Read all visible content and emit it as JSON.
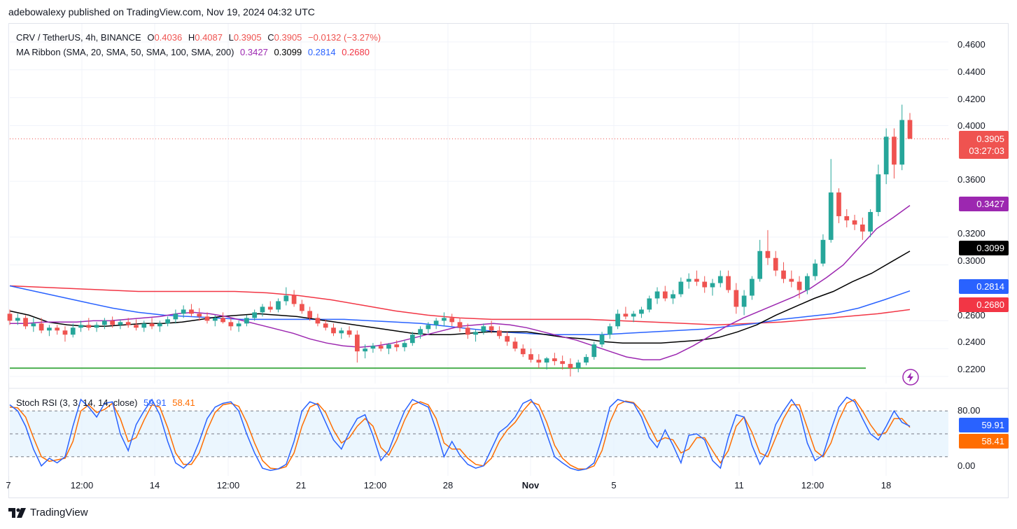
{
  "header": {
    "text": "adebowalexy published on TradingView.com, Nov 19, 2024 04:32 UTC"
  },
  "legend_main": {
    "symbol": "CRV / TetherUS, 4h, BINANCE",
    "o_label": "O",
    "o": "0.4036",
    "h_label": "H",
    "h": "0.4087",
    "l_label": "L",
    "l": "0.3905",
    "c_label": "C",
    "c": "0.3905",
    "change": "−0.0132 (−3.27%)"
  },
  "legend_ma": {
    "name": "MA Ribbon (SMA, 20, SMA, 50, SMA, 100, SMA, 200)",
    "v1": "0.3427",
    "v2": "0.3099",
    "v3": "0.2814",
    "v4": "0.2680"
  },
  "legend_rsi": {
    "name": "Stoch RSI (3, 3, 14, 14, close)",
    "k": "59.91",
    "d": "58.41"
  },
  "price_tags": {
    "last_price": "0.3905",
    "countdown": "03:27:03",
    "ma20": "0.3427",
    "ma50": "0.3099",
    "ma100": "0.2814",
    "ma200": "0.2680",
    "rsi_k": "59.91",
    "rsi_d": "58.41"
  },
  "colors": {
    "up": "#26a69a",
    "down": "#ef5350",
    "ma20": "#9c27b0",
    "ma50": "#000000",
    "ma100": "#2962ff",
    "ma200": "#f23645",
    "support": "#4caf50",
    "rsi_k": "#2962ff",
    "rsi_d": "#ff6d00",
    "rsi_band": "#e3f2fd"
  },
  "footer": {
    "brand": "TradingView",
    "logo_icon": "tradingview-logo-icon"
  },
  "chart_data": [
    {
      "type": "candlestick",
      "title": "CRV / TetherUS, 4h, BINANCE",
      "y_axis_ticks": [
        "0.4600",
        "0.4400",
        "0.4200",
        "0.4000",
        "0.3600",
        "0.3200",
        "0.3000",
        "0.2600",
        "0.2400",
        "0.2200"
      ],
      "x_axis_ticks": [
        "7",
        "12:00",
        "14",
        "12:00",
        "21",
        "12:00",
        "28",
        "Nov",
        "5",
        "11",
        "12:00",
        "18"
      ],
      "ylim": [
        0.215,
        0.47
      ],
      "ohlc": [
        [
          0.265,
          0.268,
          0.257,
          0.26
        ],
        [
          0.26,
          0.265,
          0.257,
          0.262
        ],
        [
          0.262,
          0.264,
          0.254,
          0.256
        ],
        [
          0.256,
          0.262,
          0.252,
          0.258
        ],
        [
          0.258,
          0.262,
          0.251,
          0.253
        ],
        [
          0.253,
          0.257,
          0.249,
          0.255
        ],
        [
          0.255,
          0.257,
          0.25,
          0.253
        ],
        [
          0.253,
          0.256,
          0.245,
          0.25
        ],
        [
          0.25,
          0.258,
          0.248,
          0.255
        ],
        [
          0.255,
          0.26,
          0.252,
          0.257
        ],
        [
          0.257,
          0.262,
          0.253,
          0.255
        ],
        [
          0.255,
          0.259,
          0.252,
          0.257
        ],
        [
          0.257,
          0.262,
          0.254,
          0.26
        ],
        [
          0.26,
          0.263,
          0.255,
          0.257
        ],
        [
          0.257,
          0.261,
          0.254,
          0.259
        ],
        [
          0.259,
          0.262,
          0.255,
          0.257
        ],
        [
          0.257,
          0.261,
          0.253,
          0.255
        ],
        [
          0.255,
          0.26,
          0.252,
          0.258
        ],
        [
          0.258,
          0.262,
          0.254,
          0.256
        ],
        [
          0.256,
          0.26,
          0.252,
          0.258
        ],
        [
          0.258,
          0.263,
          0.256,
          0.261
        ],
        [
          0.261,
          0.268,
          0.258,
          0.265
        ],
        [
          0.265,
          0.271,
          0.262,
          0.268
        ],
        [
          0.268,
          0.272,
          0.263,
          0.265
        ],
        [
          0.265,
          0.269,
          0.26,
          0.263
        ],
        [
          0.263,
          0.266,
          0.258,
          0.26
        ],
        [
          0.26,
          0.264,
          0.256,
          0.262
        ],
        [
          0.262,
          0.266,
          0.258,
          0.259
        ],
        [
          0.259,
          0.262,
          0.253,
          0.256
        ],
        [
          0.256,
          0.26,
          0.252,
          0.258
        ],
        [
          0.258,
          0.264,
          0.256,
          0.262
        ],
        [
          0.262,
          0.268,
          0.26,
          0.266
        ],
        [
          0.266,
          0.272,
          0.263,
          0.27
        ],
        [
          0.27,
          0.274,
          0.266,
          0.268
        ],
        [
          0.268,
          0.276,
          0.266,
          0.274
        ],
        [
          0.274,
          0.284,
          0.271,
          0.278
        ],
        [
          0.278,
          0.282,
          0.27,
          0.272
        ],
        [
          0.272,
          0.275,
          0.265,
          0.267
        ],
        [
          0.267,
          0.27,
          0.26,
          0.262
        ],
        [
          0.262,
          0.265,
          0.256,
          0.258
        ],
        [
          0.258,
          0.261,
          0.253,
          0.255
        ],
        [
          0.255,
          0.258,
          0.249,
          0.251
        ],
        [
          0.251,
          0.255,
          0.247,
          0.253
        ],
        [
          0.253,
          0.256,
          0.248,
          0.25
        ],
        [
          0.25,
          0.253,
          0.23,
          0.238
        ],
        [
          0.238,
          0.243,
          0.233,
          0.24
        ],
        [
          0.24,
          0.244,
          0.237,
          0.242
        ],
        [
          0.242,
          0.245,
          0.238,
          0.24
        ],
        [
          0.24,
          0.244,
          0.236,
          0.243
        ],
        [
          0.243,
          0.246,
          0.238,
          0.241
        ],
        [
          0.241,
          0.246,
          0.238,
          0.244
        ],
        [
          0.244,
          0.252,
          0.242,
          0.25
        ],
        [
          0.25,
          0.256,
          0.247,
          0.254
        ],
        [
          0.254,
          0.259,
          0.251,
          0.257
        ],
        [
          0.257,
          0.262,
          0.254,
          0.26
        ],
        [
          0.26,
          0.266,
          0.256,
          0.262
        ],
        [
          0.262,
          0.265,
          0.256,
          0.259
        ],
        [
          0.259,
          0.262,
          0.252,
          0.255
        ],
        [
          0.255,
          0.258,
          0.247,
          0.25
        ],
        [
          0.25,
          0.254,
          0.245,
          0.252
        ],
        [
          0.252,
          0.258,
          0.25,
          0.256
        ],
        [
          0.256,
          0.26,
          0.251,
          0.253
        ],
        [
          0.253,
          0.256,
          0.247,
          0.249
        ],
        [
          0.249,
          0.252,
          0.242,
          0.245
        ],
        [
          0.245,
          0.248,
          0.238,
          0.24
        ],
        [
          0.24,
          0.243,
          0.234,
          0.236
        ],
        [
          0.236,
          0.24,
          0.23,
          0.232
        ],
        [
          0.232,
          0.236,
          0.226,
          0.23
        ],
        [
          0.23,
          0.234,
          0.225,
          0.233
        ],
        [
          0.233,
          0.237,
          0.228,
          0.231
        ],
        [
          0.231,
          0.235,
          0.225,
          0.229
        ],
        [
          0.229,
          0.233,
          0.22,
          0.226
        ],
        [
          0.226,
          0.232,
          0.223,
          0.23
        ],
        [
          0.23,
          0.236,
          0.228,
          0.234
        ],
        [
          0.234,
          0.245,
          0.232,
          0.243
        ],
        [
          0.243,
          0.252,
          0.241,
          0.25
        ],
        [
          0.25,
          0.258,
          0.247,
          0.256
        ],
        [
          0.256,
          0.268,
          0.254,
          0.265
        ],
        [
          0.265,
          0.27,
          0.261,
          0.263
        ],
        [
          0.263,
          0.267,
          0.259,
          0.265
        ],
        [
          0.265,
          0.27,
          0.262,
          0.268
        ],
        [
          0.268,
          0.278,
          0.266,
          0.276
        ],
        [
          0.276,
          0.284,
          0.272,
          0.281
        ],
        [
          0.281,
          0.285,
          0.274,
          0.276
        ],
        [
          0.276,
          0.282,
          0.272,
          0.279
        ],
        [
          0.279,
          0.291,
          0.277,
          0.288
        ],
        [
          0.288,
          0.294,
          0.283,
          0.29
        ],
        [
          0.29,
          0.296,
          0.285,
          0.288
        ],
        [
          0.288,
          0.292,
          0.28,
          0.284
        ],
        [
          0.284,
          0.29,
          0.278,
          0.287
        ],
        [
          0.287,
          0.296,
          0.284,
          0.292
        ],
        [
          0.292,
          0.296,
          0.28,
          0.282
        ],
        [
          0.282,
          0.287,
          0.265,
          0.27
        ],
        [
          0.27,
          0.282,
          0.264,
          0.278
        ],
        [
          0.278,
          0.292,
          0.275,
          0.29
        ],
        [
          0.29,
          0.318,
          0.288,
          0.31
        ],
        [
          0.31,
          0.325,
          0.3,
          0.305
        ],
        [
          0.305,
          0.31,
          0.292,
          0.296
        ],
        [
          0.296,
          0.302,
          0.287,
          0.29
        ],
        [
          0.29,
          0.296,
          0.284,
          0.288
        ],
        [
          0.288,
          0.292,
          0.276,
          0.282
        ],
        [
          0.282,
          0.294,
          0.279,
          0.292
        ],
        [
          0.292,
          0.304,
          0.289,
          0.301
        ],
        [
          0.301,
          0.322,
          0.299,
          0.318
        ],
        [
          0.318,
          0.376,
          0.316,
          0.352
        ],
        [
          0.352,
          0.355,
          0.33,
          0.335
        ],
        [
          0.335,
          0.34,
          0.327,
          0.332
        ],
        [
          0.332,
          0.336,
          0.325,
          0.329
        ],
        [
          0.329,
          0.334,
          0.318,
          0.324
        ],
        [
          0.324,
          0.34,
          0.32,
          0.338
        ],
        [
          0.338,
          0.372,
          0.335,
          0.365
        ],
        [
          0.365,
          0.398,
          0.358,
          0.392
        ],
        [
          0.392,
          0.398,
          0.362,
          0.372
        ],
        [
          0.372,
          0.415,
          0.368,
          0.404
        ],
        [
          0.404,
          0.409,
          0.3905,
          0.3905
        ]
      ],
      "ma20": [
        0.258,
        0.258,
        0.259,
        0.259,
        0.259,
        0.26,
        0.26,
        0.261,
        0.262,
        0.263,
        0.265,
        0.266,
        0.265,
        0.263,
        0.26,
        0.257,
        0.254,
        0.251,
        0.247,
        0.244,
        0.242,
        0.241,
        0.242,
        0.244,
        0.247,
        0.25,
        0.253,
        0.256,
        0.257,
        0.258,
        0.257,
        0.255,
        0.252,
        0.249,
        0.246,
        0.242,
        0.238,
        0.234,
        0.232,
        0.232,
        0.236,
        0.242,
        0.249,
        0.256,
        0.262,
        0.267,
        0.272,
        0.277,
        0.283,
        0.291,
        0.3,
        0.313,
        0.326,
        0.334,
        0.3427
      ],
      "ma50": [
        0.267,
        0.264,
        0.259,
        0.257,
        0.256,
        0.256,
        0.257,
        0.258,
        0.258,
        0.259,
        0.261,
        0.263,
        0.264,
        0.265,
        0.264,
        0.263,
        0.261,
        0.259,
        0.257,
        0.255,
        0.253,
        0.251,
        0.25,
        0.25,
        0.251,
        0.252,
        0.252,
        0.252,
        0.25,
        0.248,
        0.247,
        0.245,
        0.244,
        0.244,
        0.244,
        0.245,
        0.246,
        0.248,
        0.252,
        0.257,
        0.264,
        0.27,
        0.276,
        0.281,
        0.288,
        0.294,
        0.302,
        0.3099
      ],
      "ma100": [
        0.285,
        0.281,
        0.277,
        0.273,
        0.269,
        0.266,
        0.264,
        0.263,
        0.262,
        0.261,
        0.261,
        0.261,
        0.261,
        0.261,
        0.26,
        0.259,
        0.258,
        0.256,
        0.254,
        0.252,
        0.251,
        0.25,
        0.25,
        0.25,
        0.251,
        0.252,
        0.253,
        0.254,
        0.256,
        0.258,
        0.261,
        0.263,
        0.265,
        0.269,
        0.275,
        0.2814
      ],
      "ma200": [
        0.285,
        0.284,
        0.283,
        0.282,
        0.281,
        0.281,
        0.281,
        0.281,
        0.28,
        0.278,
        0.275,
        0.271,
        0.267,
        0.264,
        0.262,
        0.261,
        0.261,
        0.261,
        0.261,
        0.26,
        0.259,
        0.258,
        0.257,
        0.258,
        0.259,
        0.261,
        0.263,
        0.265,
        0.268
      ],
      "support_line": 0.226,
      "last_price": 0.3905
    },
    {
      "type": "line",
      "title": "Stoch RSI (3, 3, 14, 14, close)",
      "ylim": [
        -5,
        105
      ],
      "y_axis_ticks": [
        "80.00",
        "0.00"
      ],
      "band": [
        20,
        80
      ],
      "series": [
        {
          "name": "K",
          "values": [
            88,
            80,
            60,
            30,
            8,
            18,
            12,
            20,
            60,
            95,
            85,
            72,
            90,
            92,
            50,
            28,
            62,
            80,
            95,
            75,
            40,
            12,
            5,
            15,
            40,
            70,
            85,
            90,
            92,
            80,
            50,
            25,
            5,
            2,
            4,
            10,
            40,
            80,
            92,
            88,
            65,
            42,
            30,
            52,
            70,
            75,
            48,
            15,
            28,
            55,
            80,
            95,
            90,
            85,
            55,
            20,
            40,
            22,
            10,
            5,
            8,
            30,
            52,
            60,
            72,
            90,
            95,
            80,
            50,
            20,
            12,
            5,
            2,
            4,
            12,
            45,
            85,
            95,
            92,
            90,
            72,
            45,
            32,
            55,
            35,
            12,
            48,
            50,
            42,
            15,
            5,
            45,
            75,
            72,
            35,
            10,
            28,
            62,
            80,
            95,
            80,
            38,
            15,
            22,
            55,
            85,
            98,
            92,
            70,
            50,
            42,
            60,
            80,
            65,
            59.91
          ]
        },
        {
          "name": "D",
          "values": [
            85,
            84,
            72,
            45,
            20,
            14,
            16,
            18,
            40,
            80,
            88,
            78,
            82,
            90,
            70,
            40,
            45,
            68,
            88,
            85,
            58,
            25,
            10,
            10,
            25,
            55,
            78,
            88,
            90,
            86,
            65,
            38,
            15,
            5,
            4,
            7,
            25,
            60,
            85,
            90,
            78,
            55,
            38,
            45,
            60,
            70,
            60,
            32,
            22,
            42,
            68,
            88,
            92,
            88,
            70,
            38,
            30,
            30,
            18,
            10,
            8,
            18,
            40,
            55,
            65,
            80,
            92,
            88,
            65,
            35,
            18,
            9,
            4,
            4,
            8,
            28,
            65,
            88,
            93,
            91,
            80,
            60,
            40,
            45,
            42,
            25,
            30,
            45,
            45,
            28,
            12,
            28,
            60,
            72,
            52,
            25,
            20,
            45,
            70,
            88,
            88,
            58,
            28,
            20,
            38,
            68,
            90,
            95,
            80,
            62,
            48,
            52,
            70,
            70,
            58.41
          ]
        }
      ]
    }
  ]
}
